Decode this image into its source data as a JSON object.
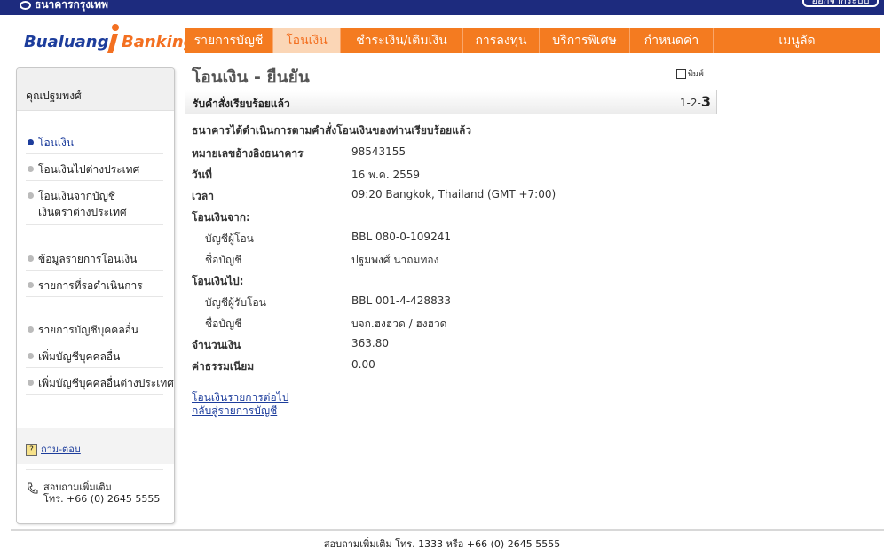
{
  "topbar": {
    "brand": "ธนาคารกรุงเทพ",
    "button": "ออกจากระบบ"
  },
  "logo": {
    "part1": "Bualuang",
    "part2": "Banking"
  },
  "nav": {
    "items": [
      {
        "label": "รายการบัญชี"
      },
      {
        "label": "โอนเงิน"
      },
      {
        "label": "ชำระเงิน/เติมเงิน"
      },
      {
        "label": "การลงทุน"
      },
      {
        "label": "บริการพิเศษ"
      },
      {
        "label": "กำหนดค่า"
      },
      {
        "label": "เมนูลัด"
      }
    ],
    "active_index": 1
  },
  "sidebar": {
    "user_name": "คุณปฐมพงศ์",
    "items": [
      {
        "label": "โอนเงิน",
        "active": true
      },
      {
        "label": "โอนเงินไปต่างประเทศ"
      },
      {
        "label": "โอนเงินจากบัญชี"
      },
      {
        "label": "เงินตราต่างประเทศ"
      },
      {
        "label": "ข้อมูลรายการโอนเงิน"
      },
      {
        "label": "รายการที่รอดำเนินการ"
      },
      {
        "label": "รายการบัญชีบุคคลอื่น"
      },
      {
        "label": "เพิ่มบัญชีบุคคลอื่น"
      },
      {
        "label": "เพิ่มบัญชีบุคคลอื่นต่างประเทศ"
      }
    ],
    "faq_label": "ถาม-ตอบ",
    "contact_line1": "สอบถามเพิ่มเติม",
    "contact_line2": "โทร. +66 (0) 2645 5555"
  },
  "content": {
    "title": "โอนเงิน - ยืนยัน",
    "print_label": "พิมพ์",
    "status": "รับคำสั่งเรียบร้อยแล้ว",
    "steps_prefix": "1-2-",
    "steps_current": "3",
    "confirm_message": "ธนาคารได้ดำเนินการตามคำสั่งโอนเงินของท่านเรียบร้อยแล้ว",
    "details": {
      "ref_label": "หมายเลขอ้างอิงธนาคาร",
      "ref_value": "98543155",
      "date_label": "วันที่",
      "date_value": "16 พ.ค. 2559",
      "time_label": "เวลา",
      "time_value": "09:20 Bangkok, Thailand (GMT +7:00)",
      "from_header": "โอนเงินจาก:",
      "from_account_label": "บัญชีผู้โอน",
      "from_account_value": "BBL 080-0-109241",
      "from_name_label": "ชื่อบัญชี",
      "from_name_value": "ปฐมพงศ์ นาถมทอง",
      "to_header": "โอนเงินไป:",
      "to_account_label": "บัญชีผู้รับโอน",
      "to_account_value": "BBL 001-4-428833",
      "to_name_label": "ชื่อบัญชี",
      "to_name_value": "บจก.ฮงฮวด / ฮงฮวด",
      "amount_label": "จำนวนเงิน",
      "amount_value": "363.80",
      "fee_label": "ค่าธรรมเนียม",
      "fee_value": "0.00"
    },
    "links": {
      "next_transfer": "โอนเงินรายการต่อไป",
      "back_accounts": "กลับสู่รายการบัญชี"
    }
  },
  "footer": {
    "text": "สอบถามเพิ่มเติม โทร. 1333 หรือ +66 (0) 2645 5555"
  },
  "colors": {
    "nav_orange": "#f47b20",
    "brand_blue": "#1d3d9c",
    "top_strip": "#1d2b7e"
  }
}
